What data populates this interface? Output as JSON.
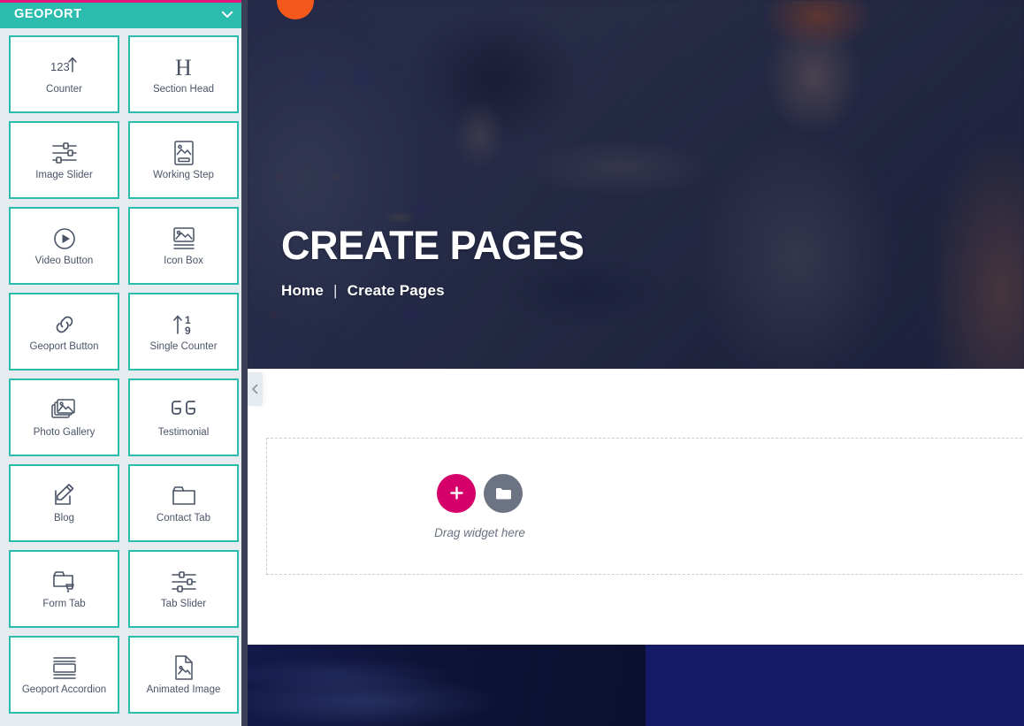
{
  "sidebar": {
    "header": {
      "title": "GEOPORT",
      "collapse_icon": "chevron-down-icon",
      "accent_color": "#2bbcae",
      "topline_color": "#e2157b"
    },
    "widgets": [
      {
        "label": "Counter",
        "icon": "counter-123-arrow-icon"
      },
      {
        "label": "Section Head",
        "icon": "heading-h-icon"
      },
      {
        "label": "Image Slider",
        "icon": "sliders-icon"
      },
      {
        "label": "Working Step",
        "icon": "image-card-icon"
      },
      {
        "label": "Video Button",
        "icon": "play-circle-icon"
      },
      {
        "label": "Icon Box",
        "icon": "image-lines-icon"
      },
      {
        "label": "Geoport Button",
        "icon": "link-chain-icon"
      },
      {
        "label": "Single Counter",
        "icon": "arrow-up-19-icon"
      },
      {
        "label": "Photo Gallery",
        "icon": "photo-stack-icon"
      },
      {
        "label": "Testimonial",
        "icon": "quote-marks-icon"
      },
      {
        "label": "Blog",
        "icon": "pencil-note-icon"
      },
      {
        "label": "Contact Tab",
        "icon": "folder-tab-icon"
      },
      {
        "label": "Form Tab",
        "icon": "folder-cart-icon"
      },
      {
        "label": "Tab Slider",
        "icon": "sliders-icon"
      },
      {
        "label": "Geoport Accordion",
        "icon": "accordion-lines-icon"
      },
      {
        "label": "Animated Image",
        "icon": "document-image-icon"
      }
    ]
  },
  "canvas": {
    "collapse_handle": {
      "icon": "chevron-left-icon"
    },
    "hero": {
      "title": "CREATE PAGES",
      "breadcrumb_home": "Home",
      "breadcrumb_separator": "|",
      "breadcrumb_current": "Create Pages",
      "accent_dot_color": "#f4591b",
      "overlay_color": "#181b3a"
    },
    "dropzone": {
      "hint": "Drag widget here",
      "add_button_icon": "plus-icon",
      "add_button_color": "#d6006b",
      "folder_button_icon": "folder-icon",
      "folder_button_color": "#6c7484"
    },
    "footer": {
      "left_color": "#0e1336",
      "right_color": "#141a66"
    }
  }
}
